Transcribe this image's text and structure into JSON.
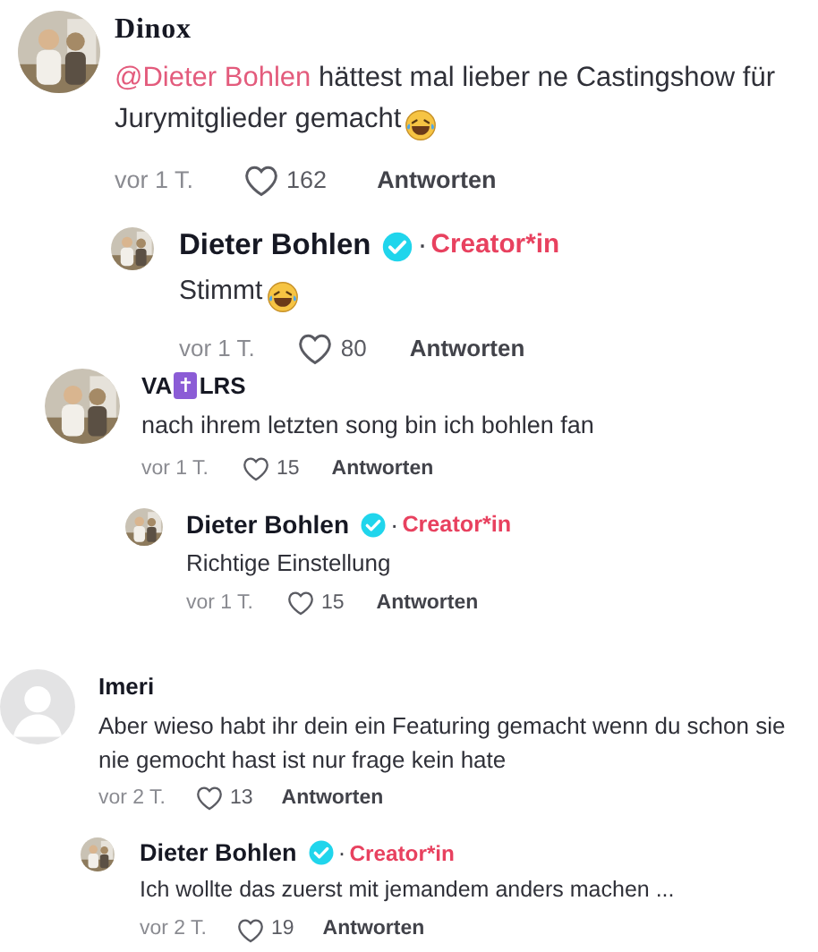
{
  "threads": [
    {
      "author": [
        {
          "kind": "text",
          "text": "Dinox"
        }
      ],
      "mention": "@Dieter Bohlen",
      "text": " hättest mal lieber ne Castingshow für Jurymitglieder gemacht",
      "emoji": true,
      "time": "vor 1 T.",
      "likes": "162",
      "reply_label": "Antworten",
      "replies": [
        {
          "author": "Dieter Bohlen",
          "verified": true,
          "separator": "·",
          "role": "Creator*in",
          "text": "Stimmt",
          "emoji": true,
          "time": "vor 1 T.",
          "likes": "80",
          "reply_label": "Antworten"
        }
      ]
    },
    {
      "author": [
        {
          "kind": "text",
          "text": "VA"
        },
        {
          "kind": "emoji",
          "text": "✝"
        },
        {
          "kind": "text",
          "text": "LRS"
        }
      ],
      "text": "nach ihrem letzten song bin ich bohlen fan",
      "emoji": false,
      "time": "vor 1 T.",
      "likes": "15",
      "reply_label": "Antworten",
      "replies": [
        {
          "author": "Dieter Bohlen",
          "verified": true,
          "separator": "·",
          "role": "Creator*in",
          "text": "Richtige Einstellung",
          "emoji": false,
          "time": "vor 1 T.",
          "likes": "15",
          "reply_label": "Antworten"
        }
      ]
    },
    {
      "author": [
        {
          "kind": "text",
          "text": "Imeri"
        }
      ],
      "avatar": {
        "kind": "default"
      },
      "text": "Aber wieso habt ihr dein ein Featuring gemacht wenn du schon sie nie gemocht hast ist nur frage kein hate",
      "emoji": false,
      "time": "vor 2 T.",
      "likes": "13",
      "reply_label": "Antworten",
      "replies": [
        {
          "author": "Dieter Bohlen",
          "verified": true,
          "separator": "·",
          "role": "Creator*in",
          "text": "Ich wollte das zuerst mit jemandem anders machen ...",
          "emoji": false,
          "time": "vor 2 T.",
          "likes": "19",
          "reply_label": "Antworten"
        }
      ]
    }
  ]
}
